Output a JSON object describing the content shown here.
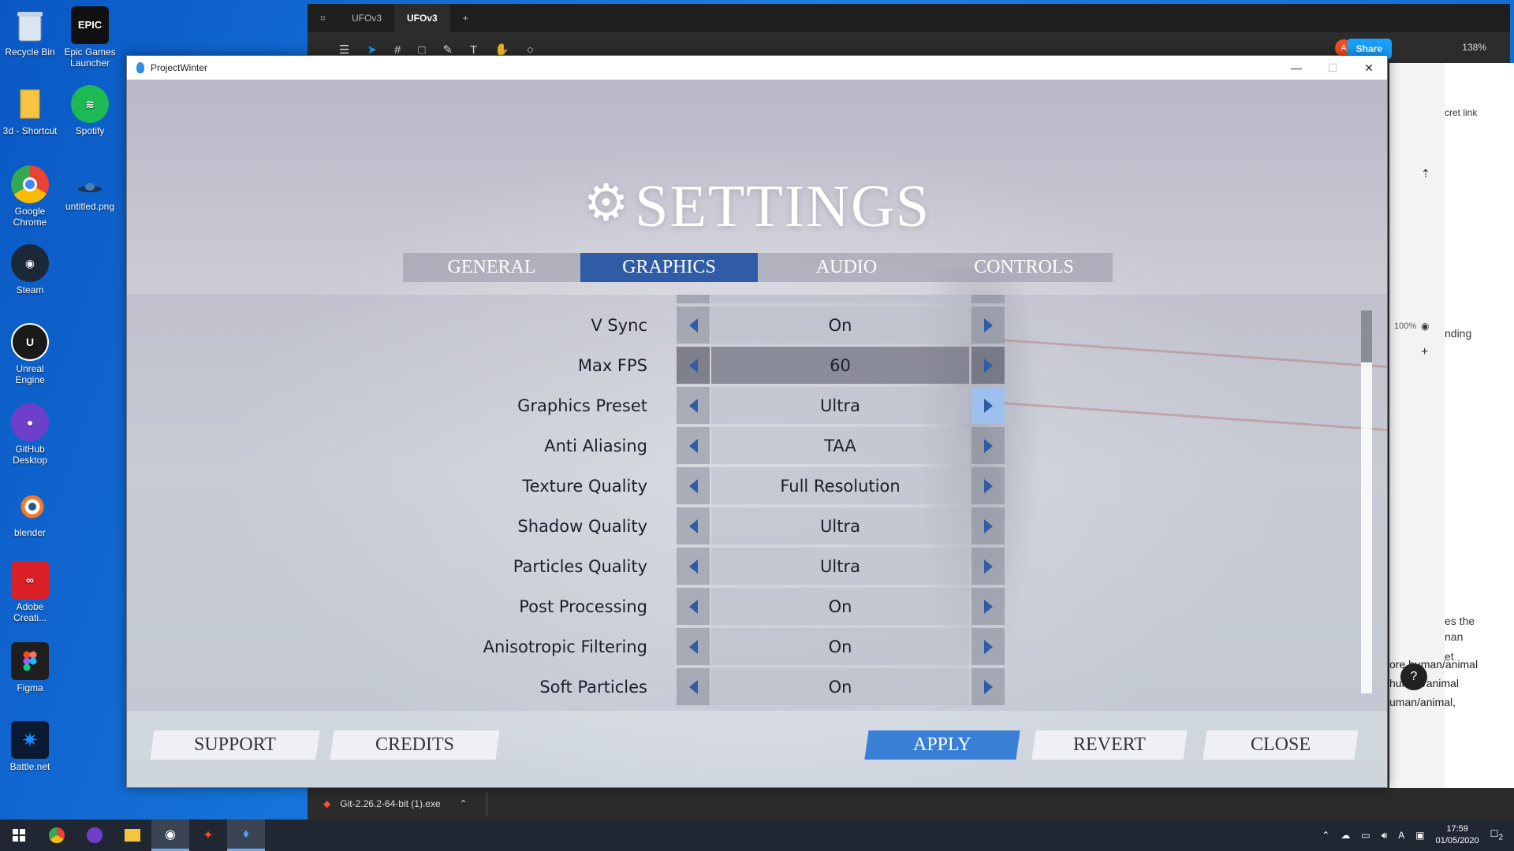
{
  "desktop": {
    "icons": [
      {
        "label": "Recycle Bin",
        "icon": "recycle-bin-icon"
      },
      {
        "label": "Epic Games Launcher",
        "icon": "epic-games-icon",
        "mark": "EPIC"
      },
      {
        "label": "3d - Shortcut",
        "icon": "folder-icon"
      },
      {
        "label": "Spotify",
        "icon": "spotify-icon"
      },
      {
        "label": "Google Chrome",
        "icon": "chrome-icon"
      },
      {
        "label": "untitled.png",
        "icon": "image-file-icon"
      },
      {
        "label": "Steam",
        "icon": "steam-icon"
      },
      {
        "label": "Unreal Engine",
        "icon": "unreal-icon"
      },
      {
        "label": "GitHub Desktop",
        "icon": "github-icon"
      },
      {
        "label": "blender",
        "icon": "blender-icon"
      },
      {
        "label": "Adobe Creati...",
        "icon": "adobe-cc-icon"
      },
      {
        "label": "Figma",
        "icon": "figma-icon"
      },
      {
        "label": "Battle.net",
        "icon": "battlenet-icon"
      }
    ]
  },
  "figma": {
    "tabs": [
      "UFOv3",
      "UFOv3"
    ],
    "share_label": "Share",
    "avatar": "A",
    "zoom": "138%",
    "right_texts": [
      "cret link",
      "nding",
      "es the",
      "nan",
      "et",
      "ore human/animal",
      "human/animal",
      "uman/animal,",
      "100%"
    ]
  },
  "git": {
    "file": "Git-2.26.2-64-bit (1).exe"
  },
  "taskbar": {
    "time": "17:59",
    "date": "01/05/2020",
    "notifications": "2"
  },
  "window": {
    "title": "ProjectWinter",
    "minimize": "—",
    "maximize": "☐",
    "close": "✕"
  },
  "settings": {
    "title": "SETTINGS",
    "tabs": [
      "GENERAL",
      "GRAPHICS",
      "AUDIO",
      "CONTROLS"
    ],
    "active_tab": "GRAPHICS",
    "rows": [
      {
        "label": "V Sync",
        "value": "On"
      },
      {
        "label": "Max FPS",
        "value": "60"
      },
      {
        "label": "Graphics Preset",
        "value": "Ultra"
      },
      {
        "label": "Anti Aliasing",
        "value": "TAA"
      },
      {
        "label": "Texture Quality",
        "value": "Full Resolution"
      },
      {
        "label": "Shadow Quality",
        "value": "Ultra"
      },
      {
        "label": "Particles Quality",
        "value": "Ultra"
      },
      {
        "label": "Post Processing",
        "value": "On"
      },
      {
        "label": "Anisotropic Filtering",
        "value": "On"
      },
      {
        "label": "Soft Particles",
        "value": "On"
      }
    ],
    "buttons": {
      "support": "SUPPORT",
      "credits": "CREDITS",
      "apply": "APPLY",
      "revert": "REVERT",
      "close": "CLOSE"
    },
    "accent": "#2f5ca5",
    "apply_color": "#3a7fd6"
  }
}
